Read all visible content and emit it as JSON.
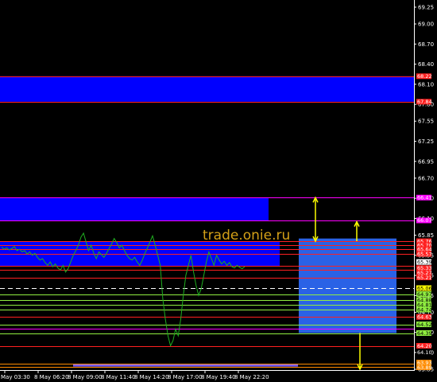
{
  "watermark": "trade.onie.ru",
  "colors": {
    "background": "#000000",
    "zone_fill": "#0000ff",
    "zone_border": "#ff3030",
    "zone_light": "#2f6dff",
    "price_line": "#1fae1f",
    "arrow": "#ffff00",
    "axis_text": "#ffffff"
  },
  "price_axis": {
    "min": 63.85,
    "max": 69.25,
    "ticks": [
      "69.25",
      "69.00",
      "68.70",
      "68.40",
      "68.10",
      "67.80",
      "67.55",
      "67.25",
      "66.95",
      "66.70",
      "66.40",
      "66.10",
      "65.85",
      "65.55",
      "65.25",
      "64.95",
      "64.70",
      "64.40",
      "64.10",
      "63.85"
    ]
  },
  "zones": [
    {
      "name": "zone-upper",
      "top": 68.22,
      "bottom": 67.84,
      "x_end": "axis"
    },
    {
      "name": "zone-middle",
      "top": 66.41,
      "bottom": 66.07,
      "x_end": "mid"
    },
    {
      "name": "zone-lower",
      "top": 65.76,
      "bottom": 65.38,
      "x_end": "axis"
    },
    {
      "name": "zone-bottom-bar",
      "top": 63.93,
      "bottom": 63.89,
      "x_end": "axis"
    },
    {
      "name": "zone-projection",
      "top": 65.8,
      "bottom": 64.39,
      "x_end": "projection"
    }
  ],
  "levels": [
    {
      "price": 68.22,
      "color": "#ff2020"
    },
    {
      "price": 67.84,
      "color": "#ff2020"
    },
    {
      "price": 66.41,
      "color": "#ff00ff"
    },
    {
      "price": 66.07,
      "color": "#ff00ff"
    },
    {
      "price": 65.76,
      "color": "#ff2020"
    },
    {
      "price": 65.7,
      "color": "#ff2020"
    },
    {
      "price": 65.64,
      "color": "#ff2020"
    },
    {
      "price": 65.57,
      "color": "#ff2020"
    },
    {
      "price": 65.39,
      "color": "#ff2020"
    },
    {
      "price": 65.33,
      "color": "#ff2020"
    },
    {
      "price": 65.21,
      "color": "#ff2020"
    },
    {
      "price": 65.06,
      "color": "#ffffff",
      "dashed": true
    },
    {
      "price": 64.97,
      "color": "#90ee40"
    },
    {
      "price": 64.88,
      "color": "#90ee40"
    },
    {
      "price": 64.81,
      "color": "#90ee40"
    },
    {
      "price": 64.74,
      "color": "#90ee40"
    },
    {
      "price": 64.63,
      "color": "#ff2020"
    },
    {
      "price": 64.52,
      "color": "#90ee40"
    },
    {
      "price": 64.45,
      "color": "#ff00ff"
    },
    {
      "price": 64.39,
      "color": "#90ee40"
    },
    {
      "price": 64.2,
      "color": "#ff2020"
    },
    {
      "price": 63.93,
      "color": "#ff8c00"
    },
    {
      "price": 63.89,
      "color": "#ff8c00"
    }
  ],
  "price_tags": [
    {
      "text": "68.22",
      "price": 68.22,
      "bg": "#ff2020",
      "fg": "#ffffff"
    },
    {
      "text": "67.84",
      "price": 67.84,
      "bg": "#ff2020",
      "fg": "#ffffff"
    },
    {
      "text": "66.41",
      "price": 66.41,
      "bg": "#ff00ff",
      "fg": "#ffffff"
    },
    {
      "text": "66.07",
      "price": 66.07,
      "bg": "#ff00ff",
      "fg": "#ffffff"
    },
    {
      "text": "65.76",
      "price": 65.76,
      "bg": "#ff2020",
      "fg": "#ffffff"
    },
    {
      "text": "65.70",
      "price": 65.7,
      "bg": "#ff2020",
      "fg": "#ffffff"
    },
    {
      "text": "65.64",
      "price": 65.64,
      "bg": "#ff2020",
      "fg": "#ffffff"
    },
    {
      "text": "65.57",
      "price": 65.57,
      "bg": "#ff2020",
      "fg": "#ffffff"
    },
    {
      "text": "65.39",
      "price": 65.45,
      "bg": "#ffffff",
      "fg": "#000000"
    },
    {
      "text": "65.33",
      "price": 65.36,
      "bg": "#ff2020",
      "fg": "#ffffff"
    },
    {
      "text": "65.27",
      "price": 65.29,
      "bg": "#ff2020",
      "fg": "#ffffff"
    },
    {
      "text": "65.21",
      "price": 65.22,
      "bg": "#ff2020",
      "fg": "#ffffff"
    },
    {
      "text": "65.06",
      "price": 65.06,
      "bg": "#ffff00",
      "fg": "#000000"
    },
    {
      "text": "64.97",
      "price": 64.97,
      "bg": "#90ee40",
      "fg": "#000000"
    },
    {
      "text": "64.88",
      "price": 64.88,
      "bg": "#90ee40",
      "fg": "#000000"
    },
    {
      "text": "64.81",
      "price": 64.81,
      "bg": "#90ee40",
      "fg": "#000000"
    },
    {
      "text": "64.74",
      "price": 64.74,
      "bg": "#90ee40",
      "fg": "#000000"
    },
    {
      "text": "64.63",
      "price": 64.63,
      "bg": "#ff2020",
      "fg": "#ffffff"
    },
    {
      "text": "64.52",
      "price": 64.52,
      "bg": "#90ee40",
      "fg": "#000000"
    },
    {
      "text": "64.39",
      "price": 64.39,
      "bg": "#90ee40",
      "fg": "#000000"
    },
    {
      "text": "64.20",
      "price": 64.2,
      "bg": "#ff2020",
      "fg": "#ffffff"
    },
    {
      "text": "64.10",
      "price": 64.1,
      "bg": "#000000",
      "fg": "#ffffff"
    },
    {
      "text": "63.93",
      "price": 63.95,
      "bg": "#ff8c00",
      "fg": "#ffffff"
    },
    {
      "text": "63.89",
      "price": 63.88,
      "bg": "#ff8c00",
      "fg": "#ffffff"
    }
  ],
  "arrows": [
    {
      "name": "arrow-up-1",
      "direction": "up",
      "from": 66.07,
      "to": 66.41,
      "slot": 1
    },
    {
      "name": "arrow-down-1",
      "direction": "down",
      "from": 66.07,
      "to": 65.76,
      "slot": 1
    },
    {
      "name": "arrow-up-2",
      "direction": "up",
      "from": 65.76,
      "to": 66.05,
      "slot": 2
    },
    {
      "name": "arrow-down-2",
      "direction": "down",
      "from": 64.39,
      "to": 63.85,
      "slot": 3
    }
  ],
  "price_series": [
    65.67,
    65.64,
    65.66,
    65.63,
    65.65,
    65.68,
    65.62,
    65.64,
    65.6,
    65.62,
    65.57,
    65.6,
    65.55,
    65.58,
    65.52,
    65.48,
    65.5,
    65.44,
    65.4,
    65.45,
    65.38,
    65.42,
    65.36,
    65.33,
    65.4,
    65.3,
    65.35,
    65.45,
    65.55,
    65.62,
    65.7,
    65.82,
    65.88,
    65.75,
    65.62,
    65.7,
    65.58,
    65.5,
    65.6,
    65.56,
    65.52,
    65.58,
    65.65,
    65.72,
    65.8,
    65.74,
    65.66,
    65.7,
    65.62,
    65.55,
    65.5,
    65.48,
    65.52,
    65.45,
    65.4,
    65.48,
    65.58,
    65.66,
    65.75,
    65.84,
    65.7,
    65.55,
    65.4,
    64.9,
    64.6,
    64.35,
    64.2,
    64.28,
    64.45,
    64.35,
    64.6,
    64.95,
    65.25,
    65.4,
    65.55,
    65.3,
    65.1,
    64.95,
    65.05,
    65.25,
    65.45,
    65.6,
    65.5,
    65.4,
    65.55,
    65.48,
    65.42,
    65.46,
    65.4,
    65.44,
    65.38,
    65.36,
    65.4,
    65.37,
    65.35,
    65.38
  ],
  "time_axis": [
    "May 03:30",
    "8 May 06:20",
    "8 May 09:00",
    "8 May 11:40",
    "8 May 14:20",
    "8 May 17:00",
    "8 May 19:40",
    "8 May 22:20"
  ]
}
